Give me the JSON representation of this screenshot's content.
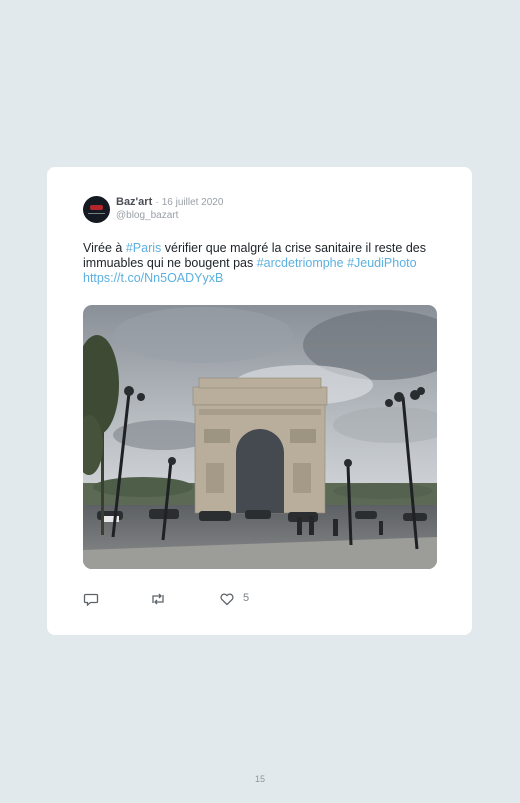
{
  "tweet": {
    "author_name": "Baz'art",
    "separator": "·",
    "date": "16 juillet 2020",
    "handle": "@blog_bazart",
    "text_parts": {
      "p1": "Virée à ",
      "tag_paris": "#Paris",
      "p2": " vérifier que malgré la crise sanitaire il reste des immuables qui ne bougent pas ",
      "tag_arc": "#arcdetriomphe",
      "tag_jeudi": "#JeudiPhoto",
      "link": "https://t.co/Nn5OADYyxB"
    },
    "image_alt": "Arc de Triomphe sous un ciel nuageux",
    "actions": {
      "reply_icon": "reply-icon",
      "retweet_icon": "retweet-icon",
      "like_icon": "heart-icon",
      "like_count": "5"
    }
  },
  "page": {
    "number": "15"
  },
  "colors": {
    "background": "#e2e9ec",
    "card": "#ffffff",
    "hashtag": "#5cb0e0",
    "text": "#1e2328",
    "muted": "#9aa0a6"
  }
}
